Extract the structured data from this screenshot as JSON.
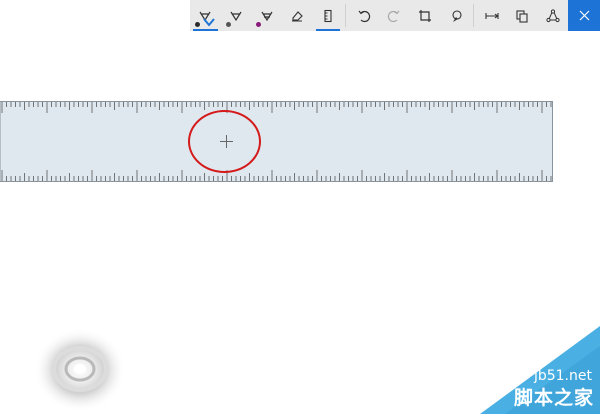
{
  "toolbar": {
    "buttons": [
      {
        "icon": "ballpoint-pen-icon",
        "pen_color": "#2b2b2b",
        "active": true
      },
      {
        "icon": "pencil-icon",
        "pen_color": "#555555"
      },
      {
        "icon": "highlighter-icon",
        "pen_color": "#8a1a7a"
      },
      {
        "icon": "eraser-icon"
      },
      {
        "icon": "ruler-icon",
        "active": true
      },
      {
        "icon": "undo-icon"
      },
      {
        "icon": "redo-icon",
        "disabled": true
      },
      {
        "icon": "crop-icon"
      },
      {
        "icon": "touch-writing-icon"
      },
      {
        "icon": "expand-icon"
      },
      {
        "icon": "copy-icon"
      },
      {
        "icon": "share-icon"
      },
      {
        "icon": "close-icon"
      }
    ],
    "accent": "#1e74d6",
    "close_bg": "#1e74d6"
  },
  "ruler": {
    "fill": "#dfe8ef",
    "tick_color": "#555555"
  },
  "annotation": {
    "circle_color": "#d41a1a"
  },
  "watermark": {
    "line1": "jb51.net",
    "line2": "脚本之家",
    "color": "#4ab0e3"
  }
}
